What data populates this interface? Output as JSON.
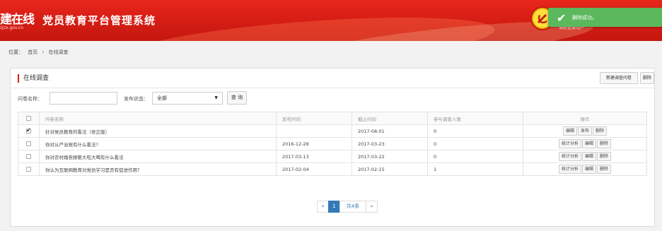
{
  "header": {
    "logo_text": "建在线",
    "logo_url": "zjzx.gov.cn",
    "system_title": "党员教育平台管理系统",
    "user_text": "当前登录用户"
  },
  "toast": {
    "icon": "check-icon",
    "text": "删除成功。"
  },
  "breadcrumb": {
    "prefix": "位置：",
    "home": "首页",
    "sep": "›",
    "current": "在线调查"
  },
  "panel": {
    "title": "在线调查",
    "new_button": "新建调查问卷",
    "delete_button": "删除"
  },
  "filter": {
    "name_label": "问卷名称：",
    "name_value": "",
    "status_label": "发布状态：",
    "status_value": "全部",
    "query_button": "查 询"
  },
  "table": {
    "headers": [
      "问卷名称",
      "发布时间",
      "截止时间",
      "参与调查人数",
      "操作"
    ],
    "rows": [
      {
        "checked": true,
        "name": "针对党员教育的看法（修正版）",
        "publish": "",
        "deadline": "2017-08-01",
        "count": "0",
        "ops": [
          "编辑",
          "发布",
          "删除"
        ]
      },
      {
        "checked": false,
        "name": "你对从严治党有什么看法?",
        "publish": "2016-12-28",
        "deadline": "2017-03-23",
        "count": "0",
        "ops": [
          "统计分析",
          "编辑",
          "删除"
        ]
      },
      {
        "checked": false,
        "name": "你对农村婚丧嫁娶大吃大喝有什么看法",
        "publish": "2017-03-13",
        "deadline": "2017-03-22",
        "count": "0",
        "ops": [
          "统计分析",
          "编辑",
          "删除"
        ]
      },
      {
        "checked": false,
        "name": "你认为互联网教育对党员学习是否有促进作用？",
        "publish": "2017-02-04",
        "deadline": "2017-02-15",
        "count": "1",
        "ops": [
          "统计分析",
          "编辑",
          "删除"
        ]
      }
    ]
  },
  "pager": {
    "prev": "«",
    "current": "1",
    "total": "共4条",
    "next": "»"
  }
}
